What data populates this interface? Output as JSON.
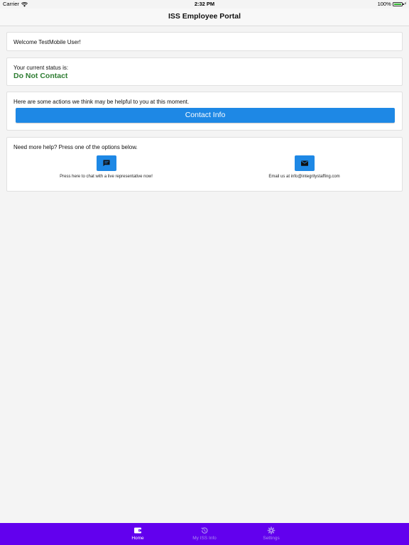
{
  "status_bar": {
    "carrier": "Carrier",
    "time": "2:32 PM",
    "battery": "100%"
  },
  "nav": {
    "title": "ISS Employee Portal"
  },
  "welcome": {
    "text": "Welcome TestMobile User!"
  },
  "status": {
    "label": "Your current status is:",
    "value": "Do Not Contact",
    "value_color": "#2e7d32"
  },
  "actions": {
    "intro": "Here are some actions we think may be helpful to you at this moment.",
    "contact_button": "Contact Info"
  },
  "help": {
    "intro": "Need more help? Press one of the options below.",
    "chat_icon": "chat-icon",
    "chat_caption": "Press here to chat with a live representative now!",
    "email_icon": "mail-icon",
    "email_caption": "Email us at info@integritystaffing.com"
  },
  "tabs": [
    {
      "label": "Home",
      "icon": "wallet-icon",
      "active": true
    },
    {
      "label": "My ISS Info",
      "icon": "history-icon",
      "active": false
    },
    {
      "label": "Settings",
      "icon": "gear-icon",
      "active": false
    }
  ],
  "colors": {
    "primary": "#1e88e5",
    "tab_bar": "#6200ee",
    "background": "#f4f4f4"
  }
}
